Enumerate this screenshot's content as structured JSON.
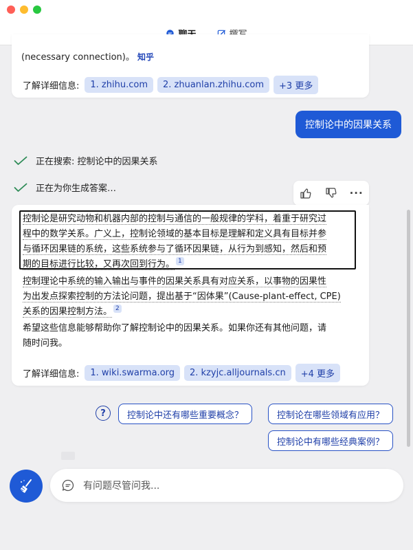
{
  "tabs": [
    {
      "label": "聊天",
      "icon": "chat-icon",
      "active": true
    },
    {
      "label": "撰写",
      "icon": "compose-icon",
      "active": false
    }
  ],
  "previous": {
    "partial_text": "(necessary connection)。",
    "source": "知乎",
    "learn_more_label": "了解详细信息:",
    "links": [
      "1. zhihu.com",
      "2. zhuanlan.zhihu.com",
      "+3 更多"
    ]
  },
  "user_message": "控制论中的因果关系",
  "status": {
    "searching": "正在搜索: 控制论中的因果关系",
    "generating": "正在为你生成答案…"
  },
  "feedback": {
    "like_icon": "thumbs-up-icon",
    "dislike_icon": "thumbs-down-icon",
    "more": "···"
  },
  "answer": {
    "p1_lines": [
      "控制论是研究动物和机器内部的控制与通信的一般规律的学科，着重于研究过",
      "程中的数学关系。广义上，控制论领域的基本目标是理解和定义具有目标并参",
      "与循环因果链的系统，这些系统参与了循环因果链，从行为到感知，然后和预",
      "期的目标进行比较，又再次回到行为。"
    ],
    "p1_cite": "1",
    "p2_lines": [
      "控制理论中系统的输入输出与事件的因果关系具有对应关系，以事物的因果性",
      "为出发点探索控制的方法论问题，提出基于“因体果”(Cause-plant-effect, CPE)",
      "关系的因果控制方法。"
    ],
    "p2_cite": "2",
    "p3_lines": [
      "希望这些信息能够帮助你了解控制论中的因果关系。如果你还有其他问题，请",
      "随时问我。"
    ],
    "learn_more_label": "了解详细信息:",
    "links": [
      "1. wiki.swarma.org",
      "2. kzyjc.alljournals.cn",
      "+4 更多"
    ]
  },
  "suggestions": [
    "控制论中还有哪些重要概念？",
    "控制论在哪些领域有应用？",
    "控制论中有哪些经典案例？"
  ],
  "input": {
    "placeholder": "有问题尽管问我..."
  },
  "colors": {
    "accent": "#1f5ad6",
    "chip_bg": "#d8e2f8",
    "chip_text": "#1f3fa8",
    "check": "#2e8b57"
  }
}
